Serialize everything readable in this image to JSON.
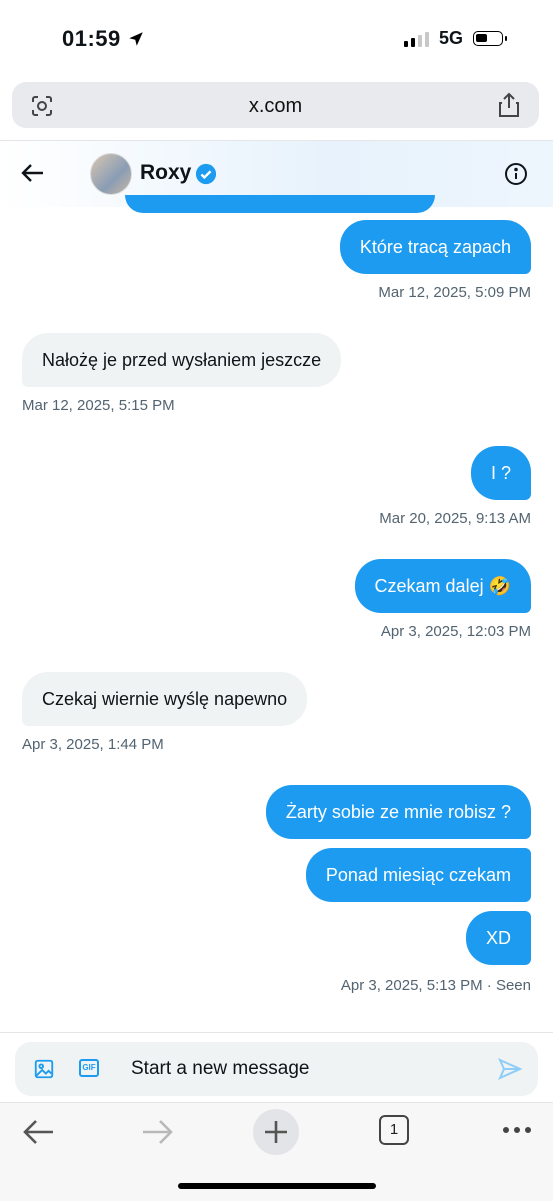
{
  "status_bar": {
    "time": "01:59",
    "network": "5G"
  },
  "browser": {
    "url": "x.com",
    "tab_count": "1"
  },
  "conversation": {
    "contact_name": "Roxy"
  },
  "messages": [
    {
      "text": "Które tracą zapach",
      "timestamp": "Mar 12, 2025, 5:09 PM"
    },
    {
      "text": "Nałożę je przed wysłaniem jeszcze",
      "timestamp": "Mar 12, 2025, 5:15 PM"
    },
    {
      "text": "I ?",
      "timestamp": "Mar 20, 2025, 9:13 AM"
    },
    {
      "text": "Czekam dalej 🤣",
      "timestamp": "Apr 3, 2025, 12:03 PM"
    },
    {
      "text": "Czekaj wiernie wyślę napewno",
      "timestamp": "Apr 3, 2025, 1:44 PM"
    },
    {
      "text": "Żarty sobie ze mnie robisz ?"
    },
    {
      "text": "Ponad miesiąc czekam"
    },
    {
      "text": "XD",
      "timestamp": "Apr 3, 2025, 5:13 PM · Seen"
    }
  ],
  "composer": {
    "placeholder": "Start a new message",
    "gif_label": "GIF"
  },
  "colors": {
    "accent": "#1d9bf0",
    "incoming_bubble": "#eff3f4",
    "timestamp": "#536471"
  },
  "icons": [
    "location-arrow-icon",
    "signal-icon",
    "battery-icon",
    "lens-icon",
    "share-icon",
    "back-arrow-icon",
    "verified-badge-icon",
    "info-icon",
    "image-icon",
    "gif-icon",
    "send-icon",
    "browser-back-icon",
    "browser-forward-icon",
    "new-tab-icon",
    "tabs-icon",
    "more-icon"
  ]
}
